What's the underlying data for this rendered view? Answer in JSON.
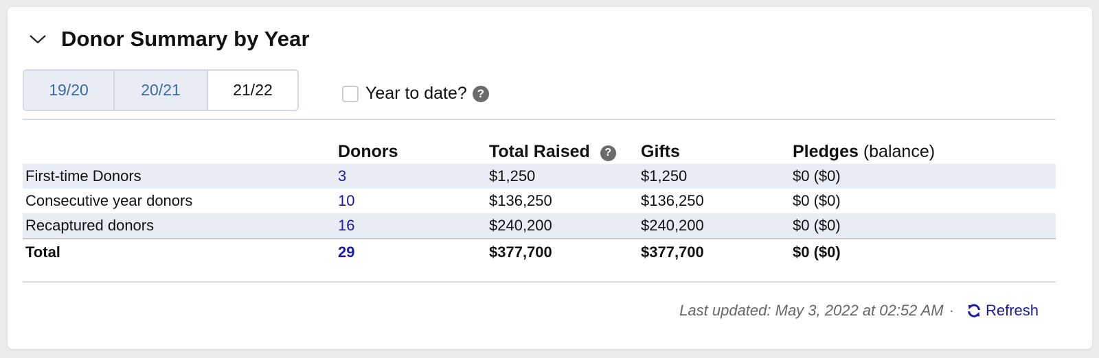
{
  "header": {
    "title": "Donor Summary by Year",
    "collapse_icon": "chevron-down-icon"
  },
  "year_tabs": [
    {
      "label": "19/20",
      "active": false
    },
    {
      "label": "20/21",
      "active": false
    },
    {
      "label": "21/22",
      "active": true
    }
  ],
  "year_to_date": {
    "label": "Year to date?",
    "checked": false,
    "help_icon": "question-circle-icon"
  },
  "table": {
    "columns": {
      "category": "",
      "donors": "Donors",
      "total_raised": "Total Raised",
      "gifts": "Gifts",
      "pledges": "Pledges",
      "pledges_sub": "(balance)"
    },
    "rows": [
      {
        "category": "First-time Donors",
        "donors": "3",
        "total_raised": "$1,250",
        "gifts": "$1,250",
        "pledges": "$0 ($0)"
      },
      {
        "category": "Consecutive year donors",
        "donors": "10",
        "total_raised": "$136,250",
        "gifts": "$136,250",
        "pledges": "$0 ($0)"
      },
      {
        "category": "Recaptured donors",
        "donors": "16",
        "total_raised": "$240,200",
        "gifts": "$240,200",
        "pledges": "$0 ($0)"
      }
    ],
    "total": {
      "category": "Total",
      "donors": "29",
      "total_raised": "$377,700",
      "gifts": "$377,700",
      "pledges": "$0 ($0)"
    }
  },
  "footer": {
    "last_updated": "Last updated: May 3, 2022 at 02:52 AM",
    "separator": "·",
    "refresh_label": "Refresh",
    "refresh_icon": "refresh-icon"
  },
  "colors": {
    "link": "#1a1aa6",
    "tab_inactive_text": "#3d68a8",
    "stripe": "#e8edf5"
  }
}
